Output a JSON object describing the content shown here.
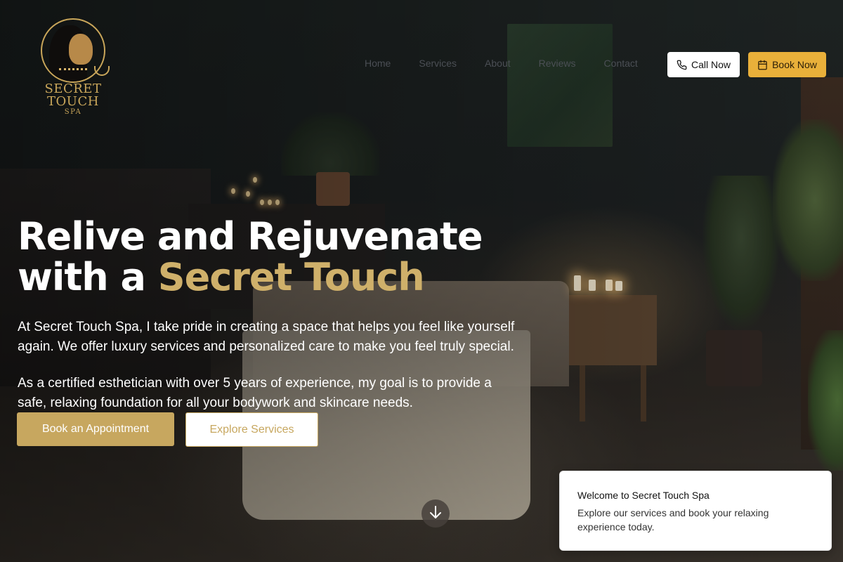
{
  "brand": {
    "logo_line1": "SECRET",
    "logo_line2": "TOUCH",
    "logo_line3": "SPA"
  },
  "nav": {
    "items": [
      {
        "label": "Home"
      },
      {
        "label": "Services"
      },
      {
        "label": "About"
      },
      {
        "label": "Reviews"
      },
      {
        "label": "Contact"
      }
    ],
    "call_label": "Call Now",
    "book_label": "Book Now"
  },
  "hero": {
    "headline_line1": "Relive and Rejuvenate",
    "headline_line2_prefix": "with a ",
    "headline_line2_highlight": "Secret Touch",
    "paragraph1": "At Secret Touch Spa, I take pride in creating a space that helps you feel like yourself again. We offer luxury services and personalized care to make you feel truly special.",
    "paragraph2": "As a certified esthetician with over 5 years of experience, my goal is to provide a safe, relaxing foundation for all your bodywork and skincare needs.",
    "primary_button": "Book an Appointment",
    "secondary_button": "Explore Services"
  },
  "icons": {
    "call": "phone-icon",
    "book": "calendar-icon",
    "scroll": "arrow-down-icon"
  },
  "colors": {
    "gold": "#cfb06a",
    "button_gold": "#c7a75f",
    "book_now_amber": "#e9b03a"
  },
  "toast": {
    "title": "Welcome to Secret Touch Spa",
    "text": "Explore our services and book your relaxing experience today."
  }
}
